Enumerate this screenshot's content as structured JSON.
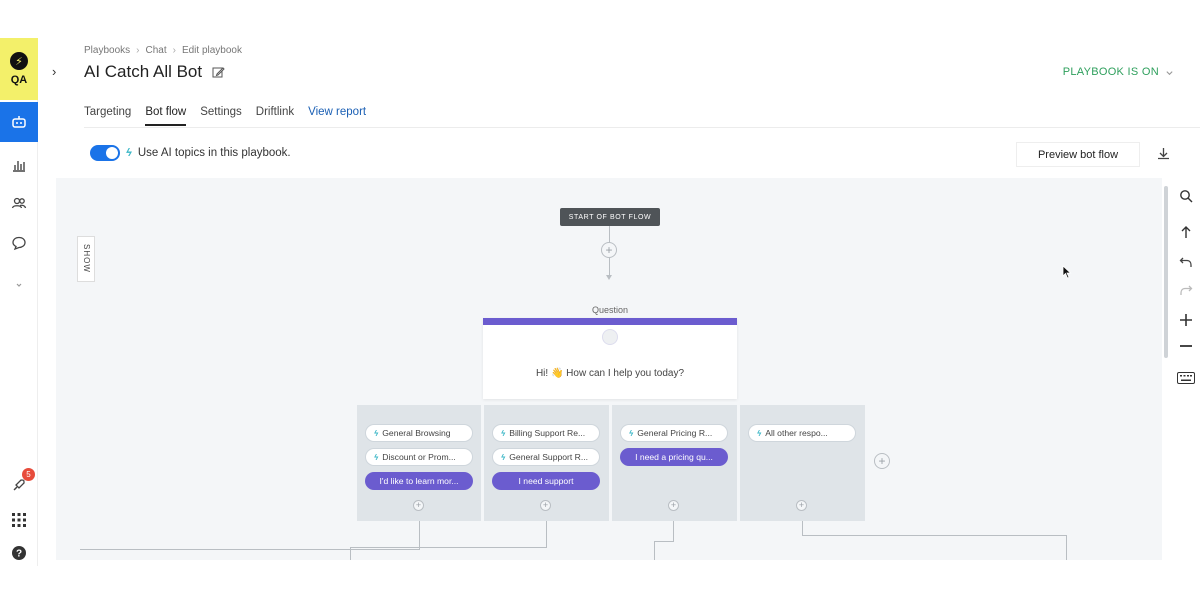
{
  "nav": {
    "org_label": "QA",
    "badge_count": "5",
    "items": [
      "bot-icon",
      "bar-chart-icon",
      "people-icon",
      "chat-bubble-icon",
      "chevron-down-icon",
      "rocket-icon",
      "grid-icon",
      "help-icon"
    ]
  },
  "breadcrumb": [
    "Playbooks",
    "Chat",
    "Edit playbook"
  ],
  "page_title": "AI Catch All Bot",
  "status": "PLAYBOOK IS ON",
  "tabs": [
    {
      "label": "Targeting"
    },
    {
      "label": "Bot flow"
    },
    {
      "label": "Settings"
    },
    {
      "label": "Driftlink"
    },
    {
      "label": "View report"
    }
  ],
  "ai_toggle": {
    "label": "Use AI topics in this playbook.",
    "on": true
  },
  "preview_button": "Preview bot flow",
  "canvas": {
    "show_tab": "SHOW",
    "start_node": "START OF BOT FLOW",
    "question_label": "Question",
    "question_text": "Hi! 👋 How can I help you today?",
    "columns": [
      {
        "chips": [
          {
            "kind": "ai",
            "text": "General Browsing"
          },
          {
            "kind": "ai",
            "text": "Discount or Prom..."
          },
          {
            "kind": "btn",
            "text": "I'd like to learn mor..."
          }
        ]
      },
      {
        "chips": [
          {
            "kind": "ai",
            "text": "Billing Support Re..."
          },
          {
            "kind": "ai",
            "text": "General Support R..."
          },
          {
            "kind": "btn",
            "text": "I need support"
          }
        ]
      },
      {
        "chips": [
          {
            "kind": "ai",
            "text": "General Pricing R..."
          },
          {
            "kind": "btn",
            "text": "I need a pricing qu..."
          }
        ]
      },
      {
        "chips": [
          {
            "kind": "ai",
            "text": "All other respo..."
          }
        ]
      }
    ]
  },
  "colors": {
    "accent": "#1a73e8",
    "question_bar": "#6b5ccf",
    "status_green": "#2e9f5c",
    "org_yellow": "#f3f06a"
  },
  "toolbar_icons": [
    "search-icon",
    "arrow-up-icon",
    "undo-icon",
    "redo-icon",
    "zoom-in-icon",
    "zoom-out-icon",
    "keyboard-icon"
  ]
}
